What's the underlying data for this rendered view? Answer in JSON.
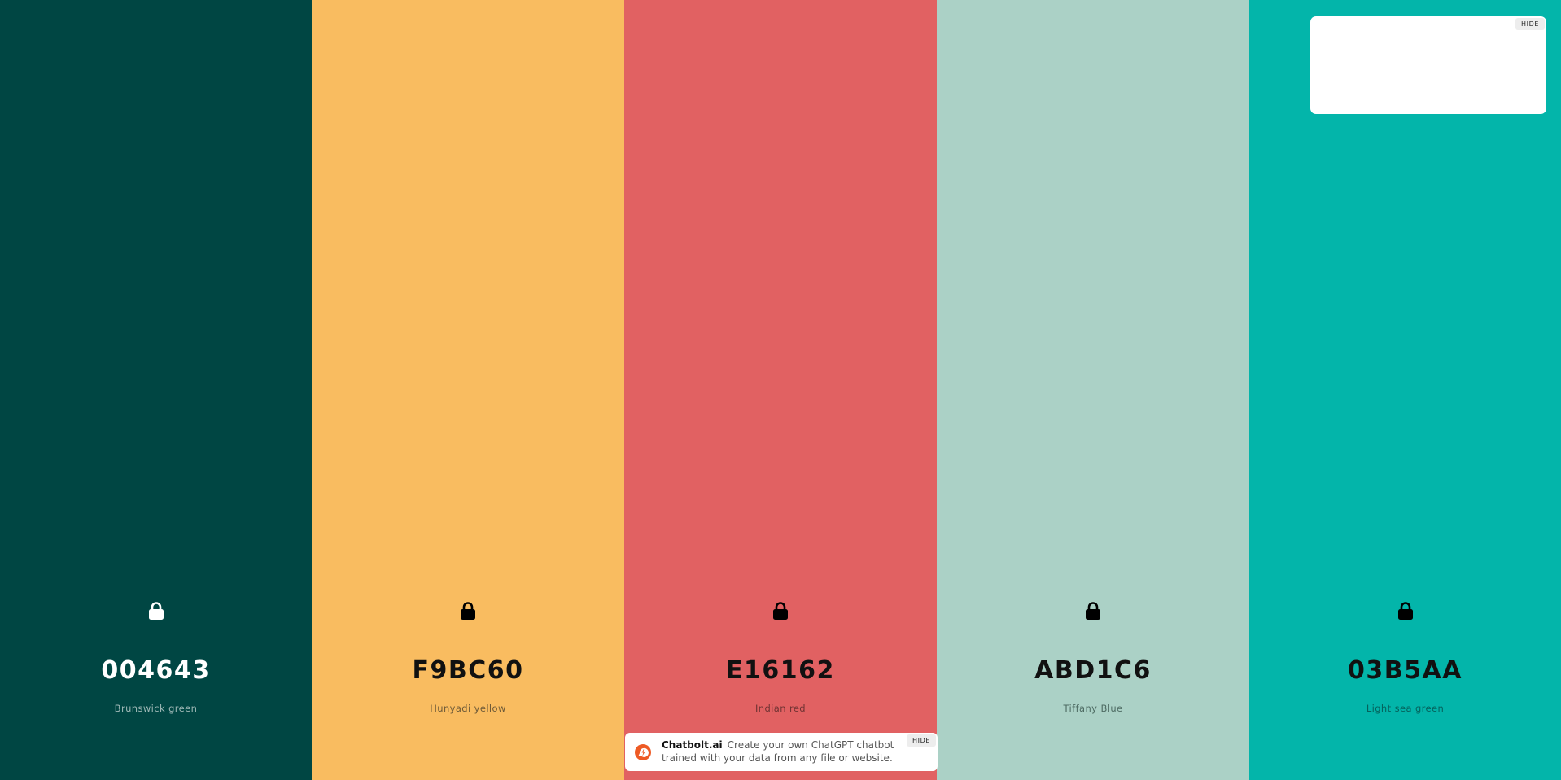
{
  "palette": {
    "colors": [
      {
        "hex": "004643",
        "name": "Brunswick green",
        "background": "#004643",
        "text_color": "#ffffff",
        "name_color": "#9fb9b7",
        "lock_color": "#ffffff"
      },
      {
        "hex": "F9BC60",
        "name": "Hunyadi yellow",
        "background": "#F9BC60",
        "text_color": "#111111",
        "name_color": "#6e5a38",
        "lock_color": "#000000"
      },
      {
        "hex": "E16162",
        "name": "Indian red",
        "background": "#E16162",
        "text_color": "#111111",
        "name_color": "#6e3232",
        "lock_color": "#000000"
      },
      {
        "hex": "ABD1C6",
        "name": "Tiffany Blue",
        "background": "#ABD1C6",
        "text_color": "#111111",
        "name_color": "#4e6b63",
        "lock_color": "#000000"
      },
      {
        "hex": "03B5AA",
        "name": "Light sea green",
        "background": "#03B5AA",
        "text_color": "#111111",
        "name_color": "#05615b",
        "lock_color": "#000000"
      }
    ],
    "lock_icon": "lock-icon"
  },
  "ad_card": {
    "hide_label": "HIDE"
  },
  "chatbot_banner": {
    "brand": "Chatbolt.ai",
    "text": "Create your own ChatGPT chatbot trained with your data from any file or website.",
    "hide_label": "HIDE",
    "logo_icon": "chatbolt-logo-icon",
    "logo_color": "#ee5a24"
  }
}
